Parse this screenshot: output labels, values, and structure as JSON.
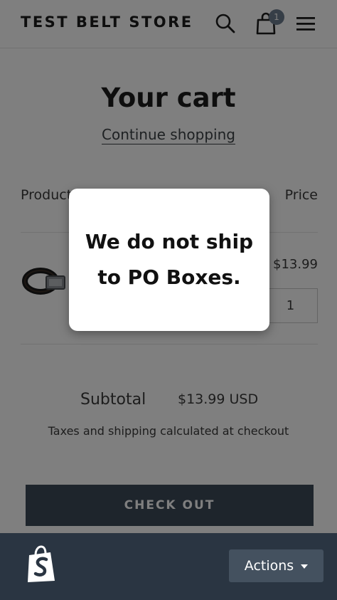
{
  "header": {
    "store_name": "TEST BELT STORE",
    "cart_count": "1",
    "icons": [
      "search-icon",
      "cart-icon",
      "menu-icon"
    ]
  },
  "cart": {
    "title": "Your cart",
    "continue_link": "Continue shopping",
    "columns": {
      "product": "Product",
      "price": "Price"
    },
    "items": [
      {
        "image_icon": "belt-image",
        "price": "$13.99",
        "quantity": "1"
      }
    ],
    "subtotal_label": "Subtotal",
    "subtotal_value": "$13.99 USD",
    "tax_note": "Taxes and shipping calculated at checkout",
    "checkout_label": "CHECK OUT"
  },
  "modal": {
    "message": "We do not ship to PO Boxes."
  },
  "bottom_bar": {
    "logo_icon": "shopify-bag-icon",
    "actions_label": "Actions",
    "background": "#2a3542"
  },
  "colors": {
    "checkout_button": "#3d4a59",
    "cart_badge": "#6d7c8e"
  }
}
